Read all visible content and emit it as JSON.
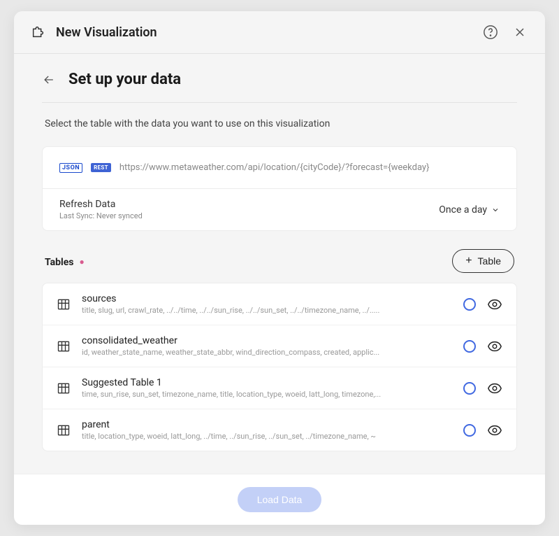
{
  "header": {
    "title": "New Visualization"
  },
  "step": {
    "title": "Set up your data",
    "description": "Select the table with the data you want to use on this visualization"
  },
  "datasource": {
    "json_label": "JSON",
    "rest_label": "REST",
    "url": "https://www.metaweather.com/api/location/{cityCode}/?forecast={weekday}",
    "refresh_label": "Refresh Data",
    "last_sync": "Last Sync: Never synced",
    "frequency": "Once a day"
  },
  "tables_section": {
    "label": "Tables",
    "add_label": "Table"
  },
  "tables": [
    {
      "name": "sources",
      "columns": "title, slug, url, crawl_rate, ../../time, ../../sun_rise, ../../sun_set, ../../timezone_name, ../....."
    },
    {
      "name": "consolidated_weather",
      "columns": "id, weather_state_name, weather_state_abbr, wind_direction_compass, created, applic..."
    },
    {
      "name": "Suggested Table 1",
      "columns": "time, sun_rise, sun_set, timezone_name, title, location_type, woeid, latt_long, timezone,..."
    },
    {
      "name": "parent",
      "columns": "title, location_type, woeid, latt_long, ../time, ../sun_rise, ../sun_set, ../timezone_name, ~"
    }
  ],
  "footer": {
    "load_label": "Load Data"
  }
}
